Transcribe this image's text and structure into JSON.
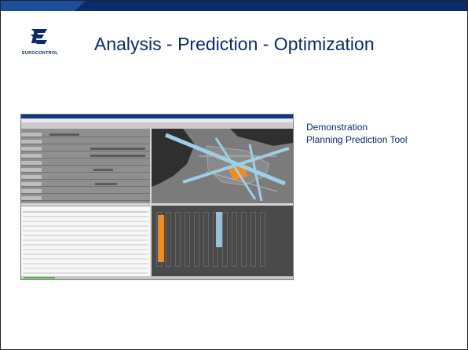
{
  "slide": {
    "title": "Analysis - Prediction - Optimization",
    "logo_text": "EUROCONTROL",
    "description_line1": "Demonstration",
    "description_line2": "Planning Prediction Tool"
  },
  "screenshot": {
    "icons": [
      "eurocontrol-logo-icon"
    ]
  },
  "colors": {
    "navy": "#0b2a6b",
    "orange": "#f28b1c",
    "light_blue": "#95c2d8",
    "green": "#57b547"
  }
}
